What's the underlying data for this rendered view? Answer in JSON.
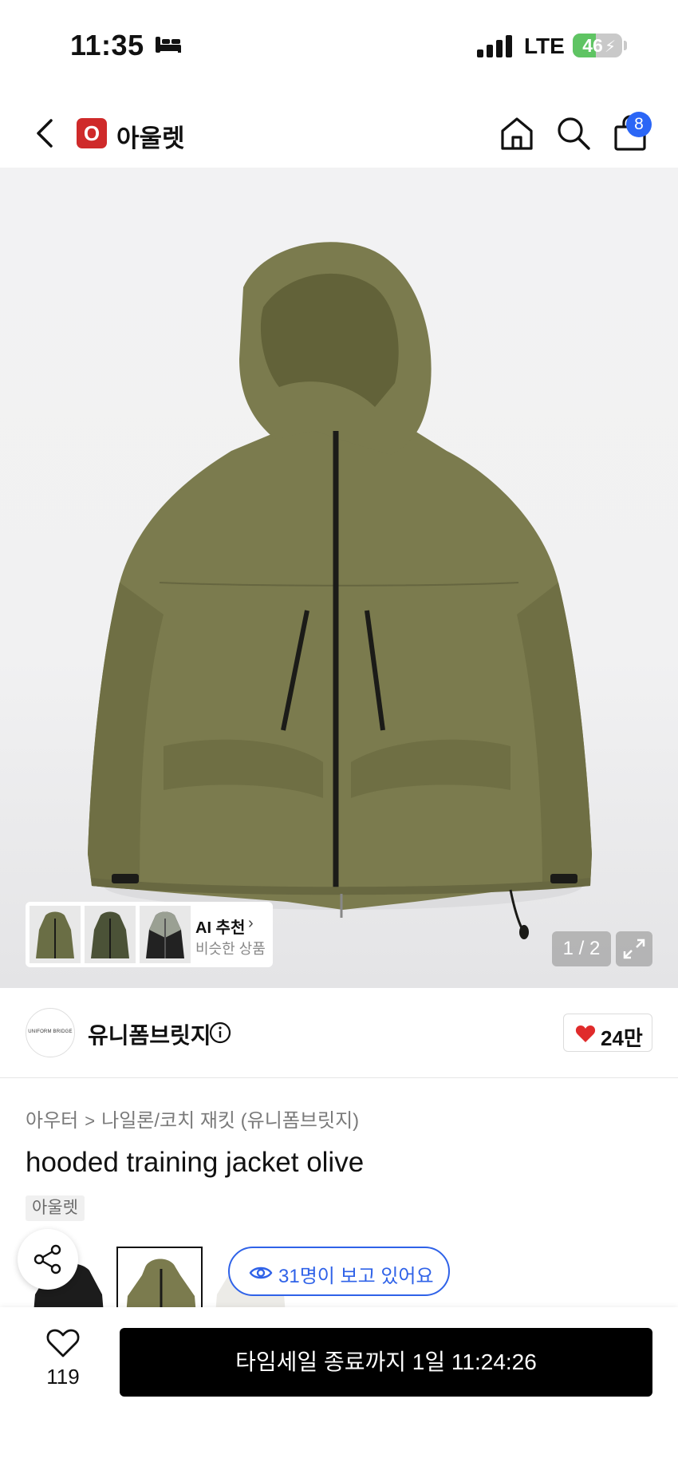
{
  "status_bar": {
    "time": "11:35",
    "network": "LTE",
    "battery_percent": 46,
    "battery_label": "46",
    "icons": [
      "sleep-icon",
      "signal-icon",
      "battery-icon"
    ]
  },
  "header": {
    "brand_logo_letter": "O",
    "brand_name": "아울렛",
    "cart_count": "8",
    "icons": [
      "back-icon",
      "home-icon",
      "search-icon",
      "cart-icon"
    ]
  },
  "gallery": {
    "ai_title": "AI 추천",
    "ai_chevron": "›",
    "ai_subtitle": "비슷한 상품",
    "counter": "1 / 2",
    "image_color": "#7b7b4e"
  },
  "store": {
    "name": "유니폼브릿지",
    "avatar_text": "UNIFORM BRIDGE",
    "likes": "24만"
  },
  "product": {
    "breadcrumb": [
      "아우터",
      "나일론/코치 재킷 (유니폼브릿지)"
    ],
    "breadcrumb_separator": ">",
    "title": "hooded training jacket olive",
    "tag": "아울렛",
    "viewers_text": "31명이 보고 있어요"
  },
  "bottom_bar": {
    "wishlist_count": "119",
    "buy_label": "타임세일 종료까지 1일 11:24:26"
  },
  "colors": {
    "accent_blue": "#2f62e8",
    "heart_red": "#e02b2b",
    "olive": "#7b7b4e"
  }
}
